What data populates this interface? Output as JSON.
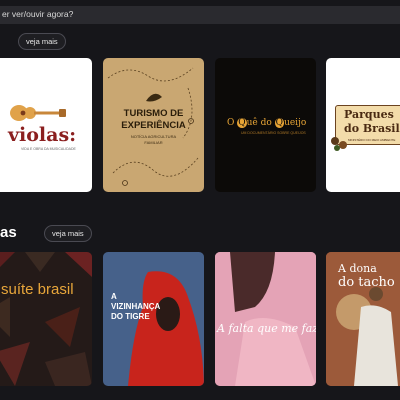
{
  "search": {
    "text": "er ver/ouvir agora?"
  },
  "section1": {
    "veja_mais": "veja mais"
  },
  "section2": {
    "title": "as",
    "veja_mais": "veja mais"
  },
  "row1": [
    {
      "title": "violas:",
      "subtitle": "VIDA E OBRA DA MUSICALIDADE"
    },
    {
      "title_line1": "TURISMO DE",
      "title_line2": "EXPERIÊNCIA",
      "subtitle1": "NOTÍCIA AGRICULTURA",
      "subtitle2": "FAMILIAR"
    },
    {
      "title_a": "O ",
      "title_b": "Q",
      "title_c": "uê do ",
      "title_d": "Q",
      "title_e": "ueijo",
      "subtitle": "UM DOCUMENTÁRIO SOBRE QUEIJOS"
    },
    {
      "title_line1": "Parques",
      "title_line2": "do Brasil",
      "subtitle": "MINISTÉRIO DO MEIO AMBIENTE"
    }
  ],
  "row2": [
    {
      "title": "suíte brasil"
    },
    {
      "title_line1": "A",
      "title_line2": "VIZINHANÇA",
      "title_line3": "DO TIGRE"
    },
    {
      "title": "A falta que me faz"
    },
    {
      "title_line1": "A dona",
      "title_line2": "do tacho"
    }
  ]
}
